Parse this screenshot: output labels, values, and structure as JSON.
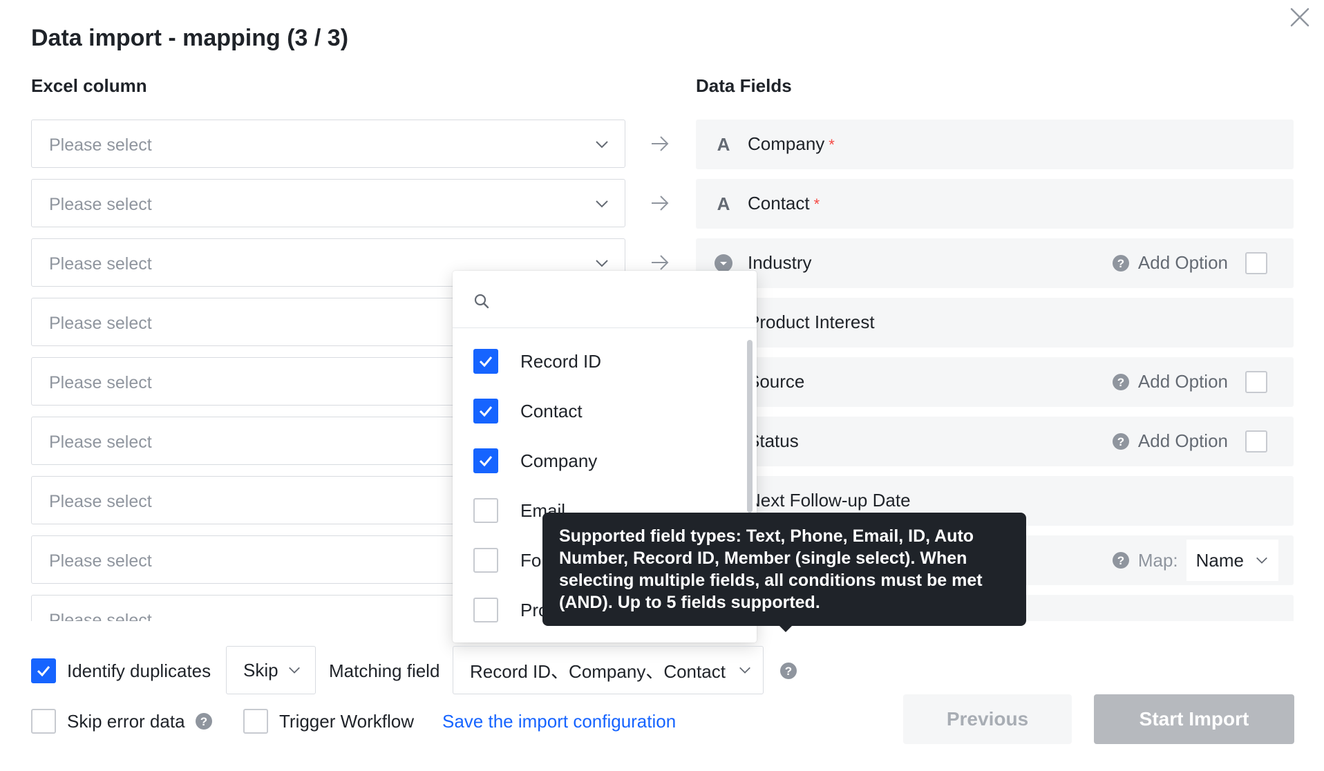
{
  "dialog": {
    "title": "Data import - mapping (3 / 3)",
    "excel_column_header": "Excel column",
    "data_fields_header": "Data Fields"
  },
  "mapping_rows": [
    {
      "placeholder": "Please select",
      "field": "Company",
      "field_icon": "text-icon",
      "icon_glyph": "A",
      "required": true,
      "required_mark": "*"
    },
    {
      "placeholder": "Please select",
      "field": "Contact",
      "field_icon": "text-icon",
      "icon_glyph": "A",
      "required": true,
      "required_mark": "*"
    },
    {
      "placeholder": "Please select",
      "field": "Industry",
      "field_icon": "single-select-icon",
      "add_option": "Add Option"
    },
    {
      "placeholder": "Please select",
      "field": "Product Interest"
    },
    {
      "placeholder": "Please select",
      "field": "Source",
      "add_option": "Add Option"
    },
    {
      "placeholder": "Please select",
      "field": "Status",
      "add_option": "Add Option"
    },
    {
      "placeholder": "Please select",
      "field": "Next Follow-up Date"
    },
    {
      "placeholder": "Please select",
      "map_label": "Map:",
      "map_value": "Name"
    },
    {
      "placeholder": "Please select"
    }
  ],
  "matching_dropdown": {
    "search_placeholder": "",
    "options": [
      {
        "label": "Record ID",
        "checked": true
      },
      {
        "label": "Contact",
        "checked": true
      },
      {
        "label": "Company",
        "checked": true
      },
      {
        "label": "Email",
        "checked": false
      },
      {
        "label": "Fol",
        "checked": false
      },
      {
        "label": "Pro",
        "checked": false
      }
    ]
  },
  "tooltip": {
    "text": "Supported field types: Text, Phone, Email, ID, Auto Number, Record ID, Member (single select). When selecting multiple fields, all conditions must be met (AND). Up to 5 fields supported."
  },
  "footer": {
    "identify_duplicates": {
      "label": "Identify duplicates",
      "checked": true
    },
    "duplicate_action": "Skip",
    "matching_field_label": "Matching field",
    "matching_field_value": "Record ID、Company、Contact",
    "skip_error_data": {
      "label": "Skip error data",
      "checked": false
    },
    "trigger_workflow": {
      "label": "Trigger Workflow",
      "checked": false
    },
    "save_config_link": "Save the import configuration",
    "previous_button": "Previous",
    "start_import_button": "Start Import"
  },
  "colors": {
    "accent": "#1664ff",
    "required": "#f54a45",
    "tooltip_bg": "#1f2329",
    "field_bg": "#f5f6f7",
    "disabled_button": "#b6b9be"
  }
}
